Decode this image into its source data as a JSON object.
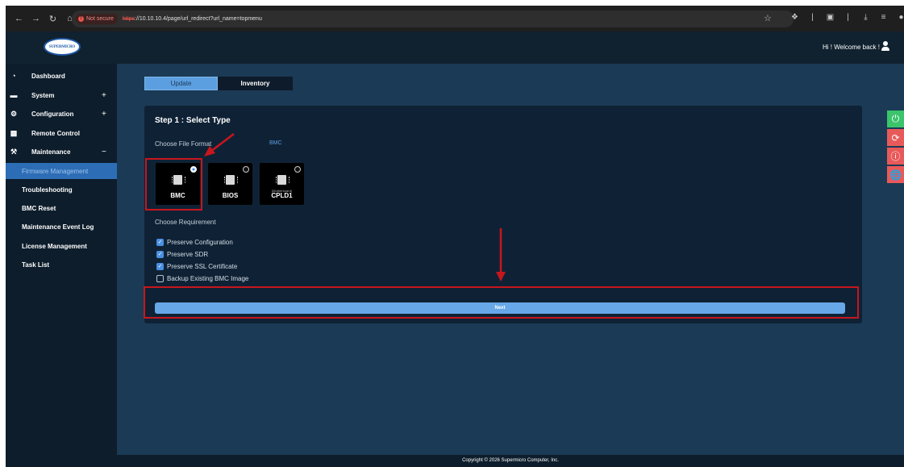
{
  "browser": {
    "not_secure_label": "Not secure",
    "url_protocol": "https",
    "url_rest": "://10.10.10.4/page/url_redirect?url_name=topmenu"
  },
  "header": {
    "logo_text": "SUPERMICRO",
    "welcome_text": "Hi ! Welcome back !"
  },
  "sidebar": {
    "items": [
      {
        "label": "Dashboard",
        "icon": "dashboard-icon",
        "toggle": ""
      },
      {
        "label": "System",
        "icon": "monitor-icon",
        "toggle": "+"
      },
      {
        "label": "Configuration",
        "icon": "gear-icon",
        "toggle": "+"
      },
      {
        "label": "Remote Control",
        "icon": "terminal-icon",
        "toggle": ""
      },
      {
        "label": "Maintenance",
        "icon": "wrench-icon",
        "toggle": "−"
      }
    ],
    "subitems": [
      {
        "label": "Firmware Management",
        "active": true
      },
      {
        "label": "Troubleshooting"
      },
      {
        "label": "BMC Reset"
      },
      {
        "label": "Maintenance Event Log"
      },
      {
        "label": "License Management"
      },
      {
        "label": "Task List"
      }
    ]
  },
  "tabs": [
    {
      "label": "Update",
      "active": true
    },
    {
      "label": "Inventory"
    }
  ],
  "step": {
    "title": "Step 1 : Select Type",
    "file_format_label": "Choose File Format",
    "file_format_value": "BMC",
    "firmware_types": [
      {
        "label": "BMC",
        "sublabel": "",
        "selected": true
      },
      {
        "label": "BIOS",
        "sublabel": "",
        "selected": false
      },
      {
        "label": "CPLD1",
        "sublabel": "(Motherboard)",
        "selected": false
      }
    ],
    "requirement_label": "Choose Requirement",
    "requirements": [
      {
        "label": "Preserve Configuration",
        "checked": true
      },
      {
        "label": "Preserve SDR",
        "checked": true
      },
      {
        "label": "Preserve SSL Certificate",
        "checked": true
      },
      {
        "label": "Backup Existing BMC Image",
        "checked": false
      }
    ],
    "next_label": "Next"
  },
  "footer": {
    "copyright": "Copyright © 2026 Supermicro Computer, Inc."
  },
  "colors": {
    "accent": "#5c9fe0",
    "annotation": "#c8161d",
    "power_button": "#3bc46b",
    "action_buttons": "#e85a5a"
  }
}
